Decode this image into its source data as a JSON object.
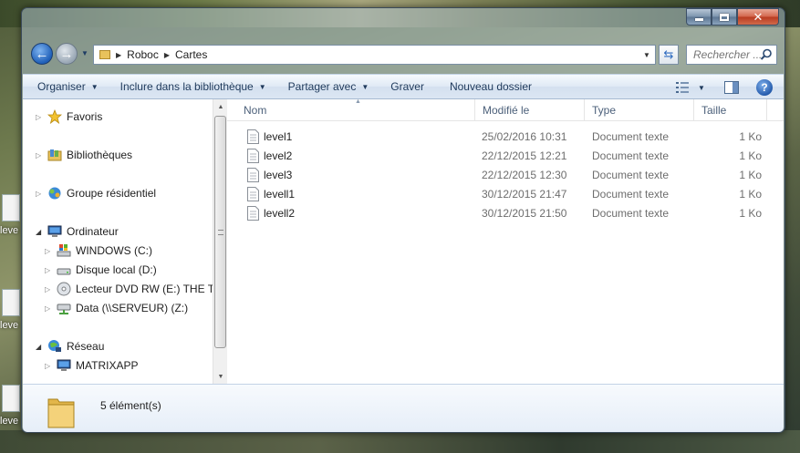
{
  "window": {
    "breadcrumb": [
      "Roboc",
      "Cartes"
    ],
    "search_placeholder": "Rechercher ..."
  },
  "toolbar": {
    "items": [
      {
        "label": "Organiser",
        "dropdown": true
      },
      {
        "label": "Inclure dans la bibliothèque",
        "dropdown": true
      },
      {
        "label": "Partager avec",
        "dropdown": true
      },
      {
        "label": "Graver",
        "dropdown": false
      },
      {
        "label": "Nouveau dossier",
        "dropdown": false
      }
    ],
    "icons": [
      "view-options-icon",
      "preview-pane-icon",
      "help-icon"
    ]
  },
  "nav_pane": {
    "items": [
      {
        "label": "Favoris",
        "icon": "star-icon",
        "level": 0,
        "expanded": false
      },
      {
        "label": "Bibliothèques",
        "icon": "library-icon",
        "level": 0,
        "expanded": false
      },
      {
        "label": "Groupe résidentiel",
        "icon": "homegroup-icon",
        "level": 0,
        "expanded": false
      },
      {
        "label": "Ordinateur",
        "icon": "computer-icon",
        "level": 0,
        "expanded": true
      },
      {
        "label": "WINDOWS (C:)",
        "icon": "windows-drive-icon",
        "level": 1,
        "expanded": false
      },
      {
        "label": "Disque local (D:)",
        "icon": "hard-drive-icon",
        "level": 1,
        "expanded": false
      },
      {
        "label": "Lecteur DVD RW (E:) THE TA",
        "icon": "dvd-drive-icon",
        "level": 1,
        "expanded": false
      },
      {
        "label": "Data (\\\\SERVEUR) (Z:)",
        "icon": "network-drive-icon",
        "level": 1,
        "expanded": false
      },
      {
        "label": "Réseau",
        "icon": "network-icon",
        "level": 0,
        "expanded": true
      },
      {
        "label": "MATRIXAPP",
        "icon": "computer-icon",
        "level": 1,
        "expanded": false
      }
    ]
  },
  "file_list": {
    "columns": [
      "Nom",
      "Modifié le",
      "Type",
      "Taille"
    ],
    "rows": [
      {
        "name": "level1",
        "modified": "25/02/2016 10:31",
        "type": "Document texte",
        "size": "1 Ko"
      },
      {
        "name": "level2",
        "modified": "22/12/2015 12:21",
        "type": "Document texte",
        "size": "1 Ko"
      },
      {
        "name": "level3",
        "modified": "22/12/2015 12:30",
        "type": "Document texte",
        "size": "1 Ko"
      },
      {
        "name": "levell1",
        "modified": "30/12/2015 21:47",
        "type": "Document texte",
        "size": "1 Ko"
      },
      {
        "name": "levell2",
        "modified": "30/12/2015 21:50",
        "type": "Document texte",
        "size": "1 Ko"
      }
    ]
  },
  "details": {
    "item_count": "5 élément(s)"
  },
  "desktop": {
    "icons": [
      "leve",
      "leve",
      "leve"
    ]
  }
}
